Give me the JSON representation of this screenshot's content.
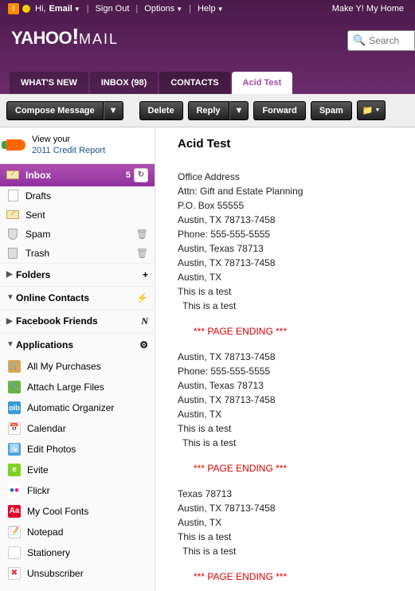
{
  "header": {
    "greeting": "Hi,",
    "email": "Email",
    "sign_out": "Sign Out",
    "options": "Options",
    "help": "Help",
    "make_home": "Make Y! My Home",
    "logo_main": "YAHOO",
    "logo_mail": "MAIL",
    "search_placeholder": "Search"
  },
  "tabs": {
    "whats_new": "WHAT'S NEW",
    "inbox": "INBOX (98)",
    "contacts": "CONTACTS",
    "acid_test": "Acid Test"
  },
  "toolbar": {
    "compose": "Compose Message",
    "delete": "Delete",
    "reply": "Reply",
    "forward": "Forward",
    "spam": "Spam"
  },
  "promo": {
    "line1": "View your",
    "line2": "2011 Credit Report"
  },
  "folders": {
    "inbox": "Inbox",
    "inbox_count": "5",
    "drafts": "Drafts",
    "sent": "Sent",
    "spam": "Spam",
    "trash": "Trash"
  },
  "sections": {
    "folders": "Folders",
    "online_contacts": "Online Contacts",
    "facebook_friends": "Facebook Friends",
    "applications": "Applications"
  },
  "apps": {
    "purchases": "All My Purchases",
    "attach": "Attach Large Files",
    "organizer": "Automatic Organizer",
    "calendar": "Calendar",
    "photos": "Edit Photos",
    "evite": "Evite",
    "flickr": "Flickr",
    "fonts": "My Cool Fonts",
    "notepad": "Notepad",
    "stationery": "Stationery",
    "unsubscriber": "Unsubscriber"
  },
  "email": {
    "title": "Acid Test",
    "block1": [
      "Office Address",
      "Attn: Gift and Estate Planning",
      "P.O. Box 55555",
      "Austin, TX 78713-7458",
      "Phone: 555-555-5555",
      "Austin, Texas 78713",
      "Austin, TX 78713-7458",
      "Austin, TX",
      "This is a test"
    ],
    "indent1": "This is a test",
    "page_end": "*** PAGE ENDING ***",
    "block2": [
      "Austin, TX 78713-7458",
      "Phone: 555-555-5555",
      "Austin, Texas 78713",
      "Austin, TX 78713-7458",
      "Austin, TX",
      "This is a test"
    ],
    "indent2": "This is a test",
    "block3": [
      "Texas 78713",
      "Austin, TX 78713-7458",
      "Austin, TX",
      "This is a test"
    ],
    "indent3": "This is a test"
  }
}
